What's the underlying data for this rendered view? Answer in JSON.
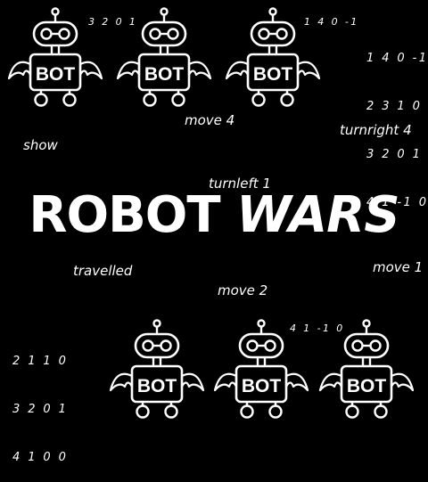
{
  "title": {
    "word1": "ROBOT",
    "word2": "WARS"
  },
  "robot_badge": "BOT",
  "commands": {
    "move4": "move 4",
    "turnright4": "turnright 4",
    "show": "show",
    "turnleft1": "turnleft 1",
    "travelled": "travelled",
    "move1": "move 1",
    "move2": "move 2"
  },
  "codes": {
    "top_first": "3 2 0 1",
    "top_third": "1 4 0 -1",
    "top_right": [
      "1 4 0 -1",
      "2 3 1 0",
      "3 2 0 1",
      "4 1 -1 0"
    ],
    "bottom_left": [
      "2 1 1 0",
      "3 2 0 1",
      "4 1 0 0"
    ],
    "bottom_second": "4 1 -1 0"
  },
  "colors": {
    "background": "#000000",
    "foreground": "#ffffff"
  }
}
